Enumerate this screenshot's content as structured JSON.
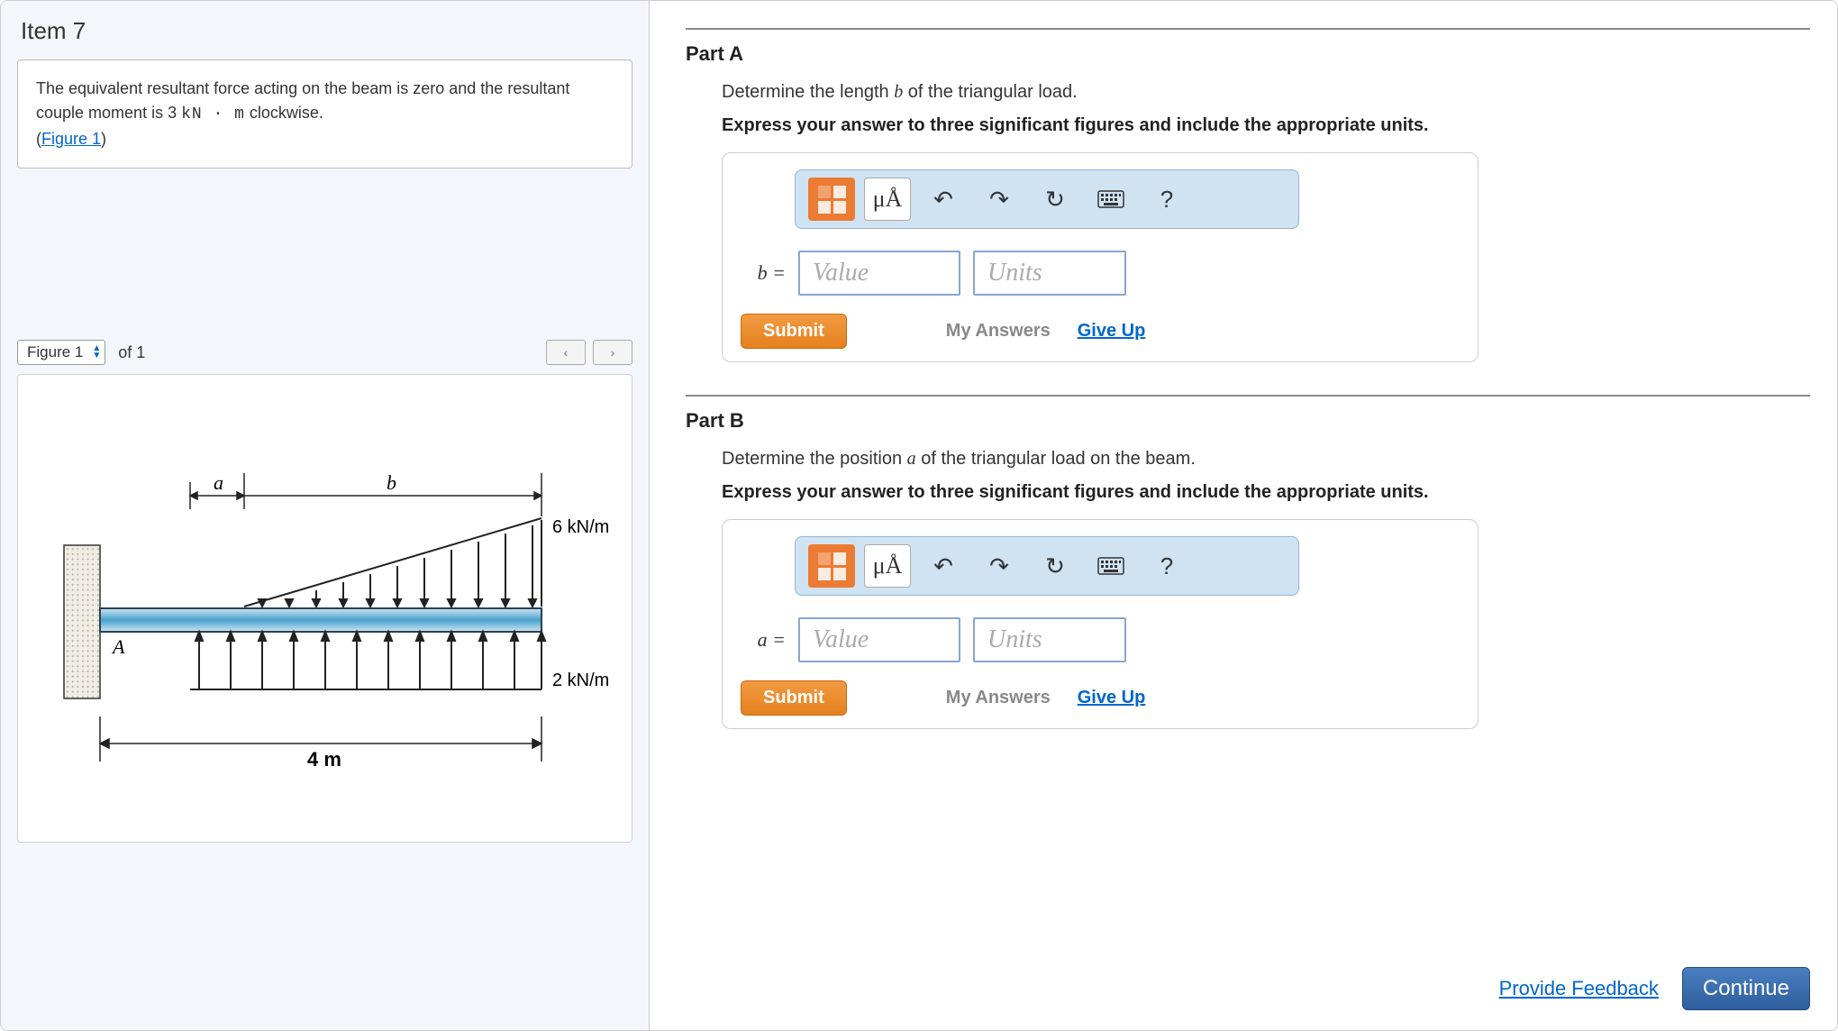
{
  "left": {
    "item_title": "Item 7",
    "problem_text_1": "The equivalent resultant force acting on the beam is zero and the resultant couple moment is 3 ",
    "problem_units": "kN · m",
    "problem_text_2": " clockwise.",
    "figure_link_prefix": "(",
    "figure_link_label": "Figure 1",
    "figure_link_suffix": ")",
    "figure_selector": {
      "label": "Figure 1",
      "of_text": "of 1",
      "prev": "‹",
      "next": "›"
    },
    "diagram": {
      "span_label_a": "a",
      "span_label_b": "b",
      "peak_load": "6 kN/m",
      "uniform_load": "2 kN/m",
      "A_label": "A",
      "total_span": "4 m"
    }
  },
  "parts": [
    {
      "heading": "Part A",
      "question": "Determine the length b of the triangular load.",
      "question_var": "b",
      "instruction": "Express your answer to three significant figures and include the appropriate units.",
      "var_prefix": "b =",
      "value_placeholder": "Value",
      "units_placeholder": "Units",
      "submit": "Submit",
      "my_answers": "My Answers",
      "give_up": "Give Up",
      "toolbar": {
        "ua_label": "μÅ",
        "help": "?"
      }
    },
    {
      "heading": "Part B",
      "question": "Determine the position a of the triangular load on the beam.",
      "question_var": "a",
      "instruction": "Express your answer to three significant figures and include the appropriate units.",
      "var_prefix": "a =",
      "value_placeholder": "Value",
      "units_placeholder": "Units",
      "submit": "Submit",
      "my_answers": "My Answers",
      "give_up": "Give Up",
      "toolbar": {
        "ua_label": "μÅ",
        "help": "?"
      }
    }
  ],
  "footer": {
    "feedback": "Provide Feedback",
    "continue": "Continue"
  }
}
